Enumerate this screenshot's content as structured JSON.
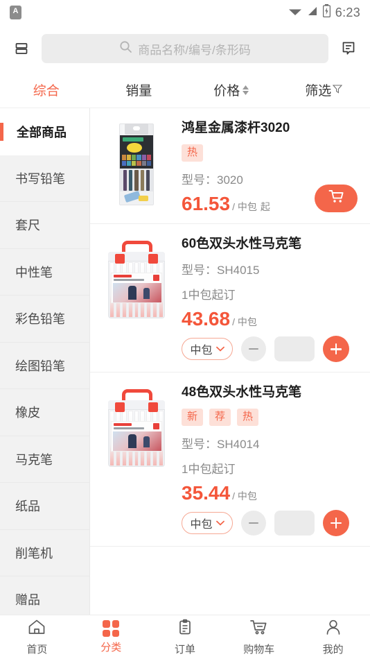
{
  "statusbar": {
    "app_icon": "A",
    "app_icon_name": "notification-app-icon",
    "wifi_icon": "wifi-icon",
    "signal_icon": "signal-icon",
    "battery_icon": "battery-charging-icon",
    "time": "6:23"
  },
  "header": {
    "left_icon": "list-layout-icon",
    "right_icon": "message-icon",
    "search": {
      "icon": "search-icon",
      "placeholder": "商品名称/编号/条形码",
      "value": ""
    }
  },
  "sort_tabs": [
    {
      "label": "综合",
      "active": true,
      "icon": ""
    },
    {
      "label": "销量",
      "active": false,
      "icon": ""
    },
    {
      "label": "价格",
      "active": false,
      "icon": "sort-arrows-icon"
    },
    {
      "label": "筛选",
      "active": false,
      "icon": "filter-funnel-icon"
    }
  ],
  "sidebar": {
    "items": [
      {
        "label": "全部商品",
        "active": true
      },
      {
        "label": "书写铅笔",
        "active": false
      },
      {
        "label": "套尺",
        "active": false
      },
      {
        "label": "中性笔",
        "active": false
      },
      {
        "label": "彩色铅笔",
        "active": false
      },
      {
        "label": "绘图铅笔",
        "active": false
      },
      {
        "label": "橡皮",
        "active": false
      },
      {
        "label": "马克笔",
        "active": false
      },
      {
        "label": "纸品",
        "active": false
      },
      {
        "label": "削笔机",
        "active": false
      },
      {
        "label": "赠品",
        "active": false
      }
    ]
  },
  "products": [
    {
      "title": "鸿星金属漆杆3020",
      "badges": [
        "热"
      ],
      "model_label": "型号：",
      "model": "3020",
      "moq": "",
      "price": "61.53",
      "price_unit": "/ 中包",
      "price_suffix": "起",
      "action": "cart-button",
      "cart_icon": "shopping-cart-icon",
      "thumb": "pencil-pack-image"
    },
    {
      "title": "60色双头水性马克笔",
      "badges": [],
      "model_label": "型号：",
      "model": "SH4015",
      "moq": "1中包起订",
      "price": "43.68",
      "price_unit": "/ 中包",
      "price_suffix": "",
      "action": "stepper",
      "unit_option": "中包",
      "unit_chevron": "chevron-down-icon",
      "qty_value": "",
      "thumb": "marker-case-image"
    },
    {
      "title": "48色双头水性马克笔",
      "badges": [
        "新",
        "荐",
        "热"
      ],
      "model_label": "型号：",
      "model": "SH4014",
      "moq": "1中包起订",
      "price": "35.44",
      "price_unit": "/ 中包",
      "price_suffix": "",
      "action": "stepper",
      "unit_option": "中包",
      "unit_chevron": "chevron-down-icon",
      "qty_value": "",
      "thumb": "marker-case-image"
    }
  ],
  "bottom_nav": [
    {
      "label": "首页",
      "icon": "home-icon",
      "active": false
    },
    {
      "label": "分类",
      "icon": "category-grid-icon",
      "active": true
    },
    {
      "label": "订单",
      "icon": "clipboard-order-icon",
      "active": false
    },
    {
      "label": "购物车",
      "icon": "shopping-cart-icon",
      "active": false
    },
    {
      "label": "我的",
      "icon": "user-profile-icon",
      "active": false
    }
  ],
  "colors": {
    "accent": "#f4664a",
    "price": "#f4563a",
    "badge_bg": "#fde0d8",
    "sidebar_bg": "#f2f2f2",
    "search_bg": "#ececec"
  }
}
